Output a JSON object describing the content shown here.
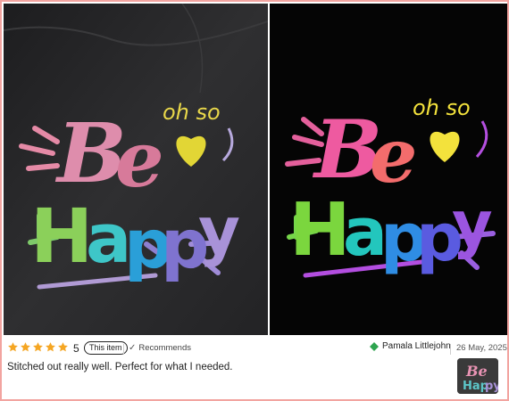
{
  "review": {
    "rating": "5",
    "this_item_badge": "This item",
    "recommends_label": "Recommends",
    "reviewer_name": "Pamala Littlejohn",
    "date": "26 May, 2025",
    "text": "Stitched out really well. Perfect for what I needed."
  },
  "photos": {
    "design_words": {
      "line1": "Be",
      "aside": "oh so",
      "line2": "Happy"
    }
  },
  "colors": {
    "star": "#f5a623",
    "reviewer_icon": "#2ea44f",
    "card_border": "#f2a4a0"
  }
}
